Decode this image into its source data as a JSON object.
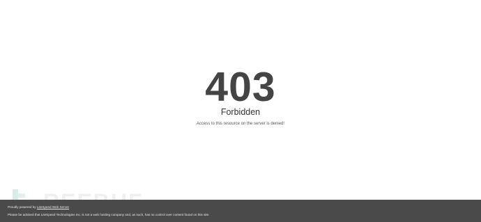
{
  "error": {
    "code": "403",
    "title": "Forbidden",
    "message": "Access to this resource on the server is denied!"
  },
  "watermark": {
    "text": "REEBUF"
  },
  "footer": {
    "powered_prefix": "Proudly powered by ",
    "powered_link": "LiteSpeed Web Server",
    "disclaimer": "Please be advised that LiteSpeed Technologies Inc. is not a web hosting company and, as such, has no control over content found on this site.",
    "background_color": "#4a4a4a"
  }
}
